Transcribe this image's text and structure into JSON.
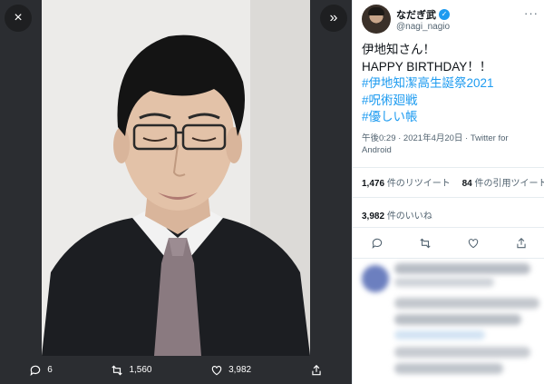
{
  "media_viewer": {
    "close_icon": "×",
    "next_icon": "»",
    "actions": {
      "reply_count": "6",
      "retweet_count": "1,560",
      "like_count": "3,982"
    }
  },
  "tweet": {
    "author": {
      "display_name": "なだぎ武",
      "handle": "@nagi_nagio",
      "verified": true
    },
    "more_icon": "···",
    "text_lines": [
      {
        "text": "伊地知さん！",
        "hashtag": false
      },
      {
        "text": "HAPPY BIRTHDAY！！",
        "hashtag": false
      },
      {
        "text": "#伊地知潔高生誕祭2021",
        "hashtag": true
      },
      {
        "text": "#呪術廻戦",
        "hashtag": true
      },
      {
        "text": "#優しい帳",
        "hashtag": true
      }
    ],
    "meta": "午後0:29 · 2021年4月20日 · Twitter for Android",
    "retweets": {
      "count": "1,476",
      "label": "件のリツイート"
    },
    "quotes": {
      "count": "84",
      "label": "件の引用ツイート"
    },
    "likes": {
      "count": "3,982",
      "label": "件のいいね"
    }
  },
  "colors": {
    "accent": "#1d9bf0",
    "viewer_bg": "#2b2d31",
    "text_primary": "#0f1419",
    "text_secondary": "#536471"
  },
  "icons": [
    "close-icon",
    "next-icon",
    "reply-icon",
    "retweet-icon",
    "like-icon",
    "share-icon",
    "verified-icon",
    "more-icon"
  ]
}
